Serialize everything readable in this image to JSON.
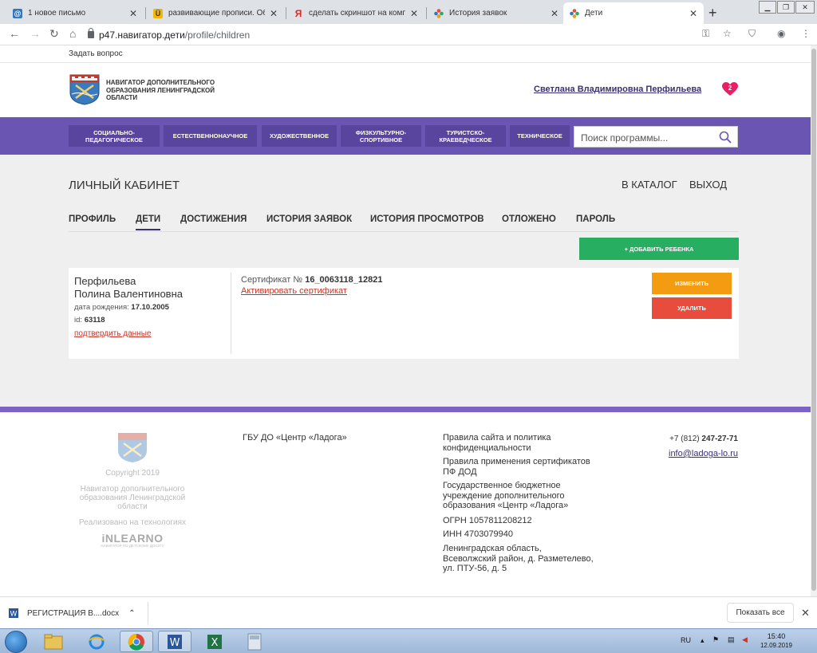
{
  "browser": {
    "tabs": [
      {
        "title": "1 новое письмо",
        "icon": "mail-icon",
        "color": "#2f78c4"
      },
      {
        "title": "развивающие прописи. Обс",
        "icon": "yandex-disk-icon",
        "color": "#f2b705"
      },
      {
        "title": "сделать скриншот на компе",
        "icon": "yandex-icon",
        "color": "#e52620"
      },
      {
        "title": "История заявок",
        "icon": "navigator-icon",
        "color": "#6a55b2"
      },
      {
        "title": "Дети",
        "icon": "navigator-icon",
        "color": "#6a55b2"
      }
    ],
    "new_tab": "+",
    "address": {
      "host": "p47.навигатор.дети",
      "path": "/profile/children"
    }
  },
  "page": {
    "ask_question": "Задать вопрос",
    "logo_text": "НАВИГАТОР ДОПОЛНИТЕЛЬНОГО ОБРАЗОВАНИЯ ЛЕНИНГРАДСКОЙ ОБЛАСТИ",
    "user_name": "Светлана Владимировна Перфильева",
    "favorites_count": "2",
    "categories": [
      "СОЦИАЛЬНО-ПЕДАГОГИЧЕСКОЕ",
      "ЕСТЕСТВЕННОНАУЧНОЕ",
      "ХУДОЖЕСТВЕННОЕ",
      "ФИЗКУЛЬТУРНО-СПОРТИВНОЕ",
      "ТУРИСТСКО-КРАЕВЕДЧЕСКОЕ",
      "ТЕХНИЧЕСКОЕ"
    ],
    "search_placeholder": "Поиск программы...",
    "cabinet_title": "ЛИЧНЫЙ КАБИНЕТ",
    "to_catalog": "В КАТАЛОГ",
    "logout": "ВЫХОД",
    "profile_tabs": [
      "ПРОФИЛЬ",
      "ДЕТИ",
      "ДОСТИЖЕНИЯ",
      "ИСТОРИЯ ЗАЯВОК",
      "ИСТОРИЯ ПРОСМОТРОВ",
      "ОТЛОЖЕНО",
      "ПАРОЛЬ"
    ],
    "active_tab": "ДЕТИ",
    "add_child": "+ ДОБАВИТЬ РЕБЕНКА",
    "child": {
      "last_name": "Перфильева",
      "first_names": "Полина Валентиновна",
      "birth_label": "дата рождения:",
      "birth_date": "17.10.2005",
      "id_label": "id:",
      "id": "63118",
      "confirm_link": "подтвердить данные",
      "cert_label": "Сертификат №",
      "cert_number": "16_0063118_12821",
      "activate_link": "Активировать сертификат",
      "edit": "ИЗМЕНИТЬ",
      "delete": "УДАЛИТЬ"
    }
  },
  "footer": {
    "copyright": "Copyright 2019",
    "navigator_name": "Навигатор дополнительного образования Ленинградской области",
    "powered_by": "Реализовано на технологиях",
    "inlearno": "iNLEARNO",
    "inlearno_sub": "НАВИГАТОР ПО ДЕТСКОМУ ДОСУГУ",
    "org_name": "ГБУ ДО «Центр «Ладога»",
    "legal": [
      "Правила сайта и политика конфиденциальности",
      "Правила применения сертификатов ПФ ДОД",
      "Государственное бюджетное учреждение дополнительного образования «Центр «Ладога»",
      "ОГРН 1057811208212",
      "ИНН 4703079940",
      "Ленинградская область, Всеволжский район, д. Разметелево, ул. ПТУ-56, д. 5"
    ],
    "phone_prefix": "+7 (812)",
    "phone_number": "247-27-71",
    "email": "info@ladoga-lo.ru"
  },
  "downloads": {
    "file": "РЕГИСТРАЦИЯ В....docx",
    "show_all": "Показать все"
  },
  "taskbar": {
    "lang": "RU",
    "time": "15:40",
    "date": "12.09.2019"
  },
  "colors": {
    "brand_purple": "#6a55b2",
    "add_green": "#27ae60",
    "edit_orange": "#f39c12",
    "delete_red": "#e74c3c"
  }
}
